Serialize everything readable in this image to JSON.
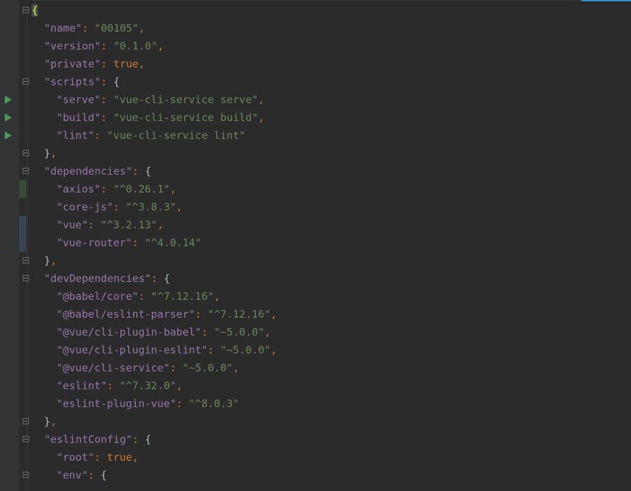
{
  "editor": {
    "language": "json",
    "colors": {
      "background": "#2b2b2b",
      "gutter": "#313335",
      "key": "#9876aa",
      "string": "#6a8759",
      "keyword": "#cc7832",
      "punctuation": "#cc7832",
      "brace": "#a9b7c6",
      "matched_brace": "#ffef28",
      "run_icon": "#499c54"
    },
    "gutter_icons": {
      "run": "run-script-icon",
      "fold": "fold-marker-icon"
    },
    "run_script_lines": [
      5,
      6,
      7
    ],
    "fold_marker_lines": [
      0,
      4,
      8,
      9,
      14,
      15,
      23,
      24,
      26
    ],
    "vcs_change_markers": [
      {
        "type": "modified",
        "lines": [
          10
        ]
      },
      {
        "type": "added",
        "lines": [
          12,
          13
        ]
      }
    ],
    "lines": [
      {
        "text": "{"
      },
      {
        "key": "\"name\"",
        "value": "\"00105\"",
        "comma": ","
      },
      {
        "key": "\"version\"",
        "value": "\"0.1.0\"",
        "comma": ","
      },
      {
        "key": "\"private\"",
        "value": "true",
        "comma": ","
      },
      {
        "key": "\"scripts\"",
        "open": "{"
      },
      {
        "key": "\"serve\"",
        "value": "\"vue-cli-service serve\"",
        "comma": ","
      },
      {
        "key": "\"build\"",
        "value": "\"vue-cli-service build\"",
        "comma": ","
      },
      {
        "key": "\"lint\"",
        "value": "\"vue-cli-service lint\""
      },
      {
        "close": "}",
        "comma": ","
      },
      {
        "key": "\"dependencies\"",
        "open": "{"
      },
      {
        "key": "\"axios\"",
        "value": "\"^0.26.1\"",
        "comma": ","
      },
      {
        "key": "\"core-js\"",
        "value": "\"^3.8.3\"",
        "comma": ","
      },
      {
        "key": "\"vue\"",
        "value": "\"^3.2.13\"",
        "comma": ","
      },
      {
        "key": "\"vue-router\"",
        "value": "\"^4.0.14\""
      },
      {
        "close": "}",
        "comma": ","
      },
      {
        "key": "\"devDependencies\"",
        "open": "{"
      },
      {
        "key": "\"@babel/core\"",
        "value": "\"^7.12.16\"",
        "comma": ","
      },
      {
        "key": "\"@babel/eslint-parser\"",
        "value": "\"^7.12.16\"",
        "comma": ","
      },
      {
        "key": "\"@vue/cli-plugin-babel\"",
        "value": "\"~5.0.0\"",
        "comma": ","
      },
      {
        "key": "\"@vue/cli-plugin-eslint\"",
        "value": "\"~5.0.0\"",
        "comma": ","
      },
      {
        "key": "\"@vue/cli-service\"",
        "value": "\"~5.0.0\"",
        "comma": ","
      },
      {
        "key": "\"eslint\"",
        "value": "\"^7.32.0\"",
        "comma": ","
      },
      {
        "key": "\"eslint-plugin-vue\"",
        "value": "\"^8.0.3\""
      },
      {
        "close": "}",
        "comma": ","
      },
      {
        "key": "\"eslintConfig\"",
        "open": "{"
      },
      {
        "key": "\"root\"",
        "value": "true",
        "comma": ","
      },
      {
        "key": "\"env\"",
        "open": "{"
      }
    ]
  }
}
